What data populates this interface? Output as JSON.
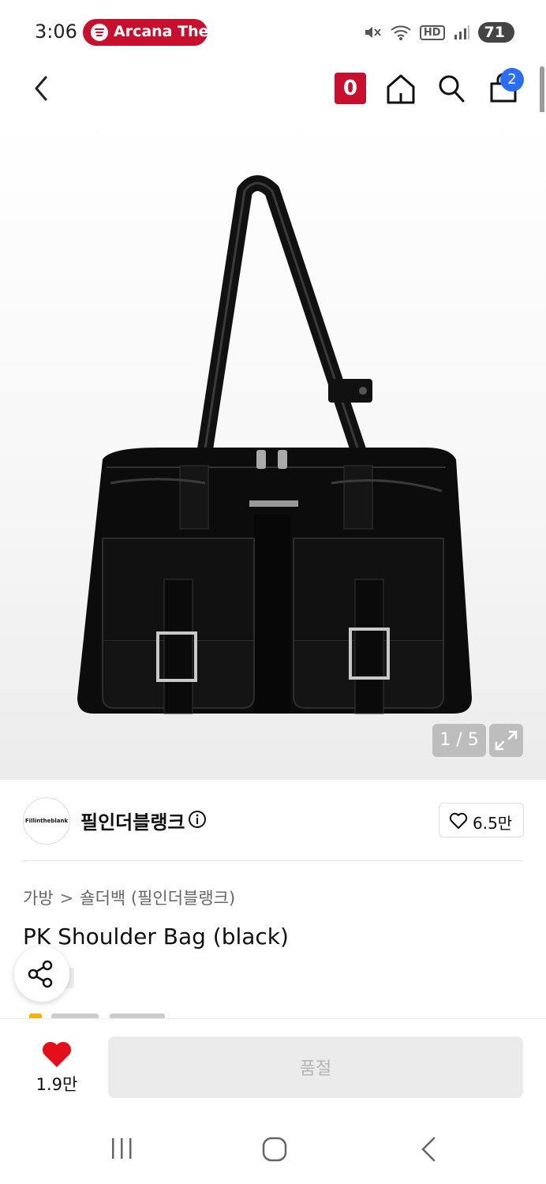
{
  "status_bar": {
    "time": "3:06",
    "media_title": "Arcana The",
    "battery": "71",
    "hd_label": "HD"
  },
  "top_nav": {
    "zero_badge": "0",
    "cart_count": "2"
  },
  "gallery": {
    "counter": "1 / 5"
  },
  "brand": {
    "logo_text": "Fillintheblank",
    "name": "필인더블랭크",
    "likes": "6.5만"
  },
  "breadcrumb": {
    "category": "가방",
    "separator": ">",
    "subcategory": "숄더백 (필인더블랭크)"
  },
  "product": {
    "title": "PK Shoulder Bag (black)"
  },
  "bottom_bar": {
    "wish_count": "1.9만",
    "soldout_label": "품절"
  },
  "colors": {
    "accent_red": "#c8102e",
    "cart_badge_blue": "#2a6ef2",
    "disabled_button": "#ebebeb"
  },
  "icons": [
    "back-icon",
    "home-icon",
    "search-icon",
    "shopping-bag-icon",
    "expand-icon",
    "info-icon",
    "heart-outline-icon",
    "share-icon",
    "heart-filled-icon"
  ]
}
